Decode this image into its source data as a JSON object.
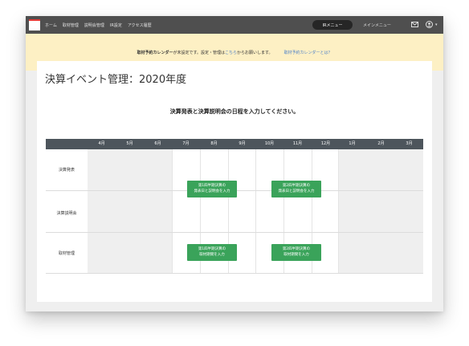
{
  "nav": {
    "items": [
      "ホーム",
      "取材管理",
      "説明会管理",
      "IR設定",
      "アクセス履歴"
    ],
    "ir_menu": "IRメニュー",
    "main_menu": "メインメニュー",
    "caret": "▾"
  },
  "notice": {
    "bold": "取材予約カレンダー",
    "text1": "が未設定です。設定・管理は",
    "link": "こちら",
    "text2": "からお願いします。",
    "help_link": "取材予約カレンダーとは？"
  },
  "page": {
    "title": "決算イベント管理：2020年度",
    "instruction": "決算発表と決算説明会の日程を入力してください。"
  },
  "table": {
    "months": [
      "4月",
      "5月",
      "6月",
      "7月",
      "8月",
      "9月",
      "10月",
      "11月",
      "12月",
      "1月",
      "2月",
      "3月"
    ],
    "rows": [
      "決算発表",
      "決算説明会",
      "取材管理"
    ]
  },
  "buttons": {
    "q1_results_line1": "第1四半期決算の",
    "q1_results_line2": "発表日と説明会を入力",
    "q2_results_line1": "第2四半期決算の",
    "q2_results_line2": "発表日と説明会を入力",
    "q1_interview_line1": "第1四半期決算の",
    "q1_interview_line2": "取材期間を入力",
    "q2_interview_line1": "第2四半期決算の",
    "q2_interview_line2": "取材期間を入力"
  },
  "colors": {
    "accent_green": "#3aa35a",
    "topbar": "#4f4f4f",
    "notice_bg": "#fdf0c4",
    "link": "#4a7fc9"
  },
  "icons": [
    "mail-icon",
    "user-icon"
  ]
}
